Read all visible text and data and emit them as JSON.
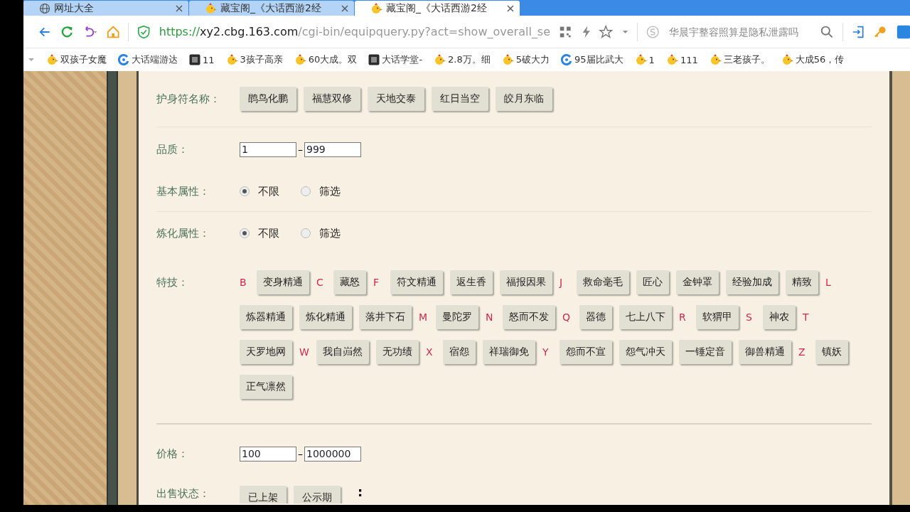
{
  "tabs": [
    {
      "title": "网址大全",
      "selected": false
    },
    {
      "title": "藏宝阁_《大话西游2经",
      "selected": false
    },
    {
      "title": "藏宝阁_《大话西游2经",
      "selected": true
    }
  ],
  "address_bar": {
    "scheme": "https://",
    "host": "xy2.cbg.163.com",
    "path": "/cgi-bin/equipquery.py?act=show_overall_se"
  },
  "search": {
    "placeholder": "华晨宇整容照算是隐私泄露吗"
  },
  "bookmarks": [
    "双孩子女魔",
    "大话端游达",
    "11",
    "3孩子高亲",
    "60大成。双",
    "大话学堂-",
    "2.8万。细",
    "5破大力",
    "95届比武大",
    "1",
    "111",
    "三老孩子。",
    "大成56，传"
  ],
  "amulet": {
    "label": "护身符名称：",
    "options": [
      "鹍鸟化鹏",
      "福慧双修",
      "天地交泰",
      "红日当空",
      "皎月东临"
    ]
  },
  "quality": {
    "label": "品质：",
    "min": "1",
    "separator": "–",
    "max": "999"
  },
  "basic_attr": {
    "label": "基本属性：",
    "options": [
      {
        "label": "不限",
        "selected": true
      },
      {
        "label": "筛选",
        "selected": false
      }
    ]
  },
  "refine_attr": {
    "label": "炼化属性：",
    "options": [
      {
        "label": "不限",
        "selected": true
      },
      {
        "label": "筛选",
        "selected": false
      }
    ]
  },
  "skills": {
    "label": "特技：",
    "items": [
      {
        "kind": "letter",
        "text": "B"
      },
      {
        "kind": "button",
        "text": "变身精通"
      },
      {
        "kind": "letter",
        "text": "C"
      },
      {
        "kind": "button",
        "text": "藏怒"
      },
      {
        "kind": "letter",
        "text": "F"
      },
      {
        "kind": "button",
        "text": "符文精通"
      },
      {
        "kind": "button",
        "text": "返生香"
      },
      {
        "kind": "button",
        "text": "福报因果"
      },
      {
        "kind": "letter",
        "text": "J"
      },
      {
        "kind": "button",
        "text": "救命毫毛"
      },
      {
        "kind": "button",
        "text": "匠心"
      },
      {
        "kind": "button",
        "text": "金钟罩"
      },
      {
        "kind": "button",
        "text": "经验加成"
      },
      {
        "kind": "button",
        "text": "精致"
      },
      {
        "kind": "letter",
        "text": "L"
      },
      {
        "kind": "button",
        "text": "炼器精通"
      },
      {
        "kind": "button",
        "text": "炼化精通"
      },
      {
        "kind": "button",
        "text": "落井下石"
      },
      {
        "kind": "letter",
        "text": "M"
      },
      {
        "kind": "button",
        "text": "曼陀罗"
      },
      {
        "kind": "letter",
        "text": "N"
      },
      {
        "kind": "button",
        "text": "怒而不发"
      },
      {
        "kind": "letter",
        "text": "Q"
      },
      {
        "kind": "button",
        "text": "器德"
      },
      {
        "kind": "button",
        "text": "七上八下"
      },
      {
        "kind": "letter",
        "text": "R"
      },
      {
        "kind": "button",
        "text": "软猬甲"
      },
      {
        "kind": "letter",
        "text": "S"
      },
      {
        "kind": "button",
        "text": "神农"
      },
      {
        "kind": "letter",
        "text": "T"
      },
      {
        "kind": "button",
        "text": "天罗地网"
      },
      {
        "kind": "letter",
        "text": "W"
      },
      {
        "kind": "button",
        "text": "我自岿然"
      },
      {
        "kind": "button",
        "text": "无功绩"
      },
      {
        "kind": "letter",
        "text": "X"
      },
      {
        "kind": "button",
        "text": "宿怨"
      },
      {
        "kind": "button",
        "text": "祥瑞御免"
      },
      {
        "kind": "letter",
        "text": "Y"
      },
      {
        "kind": "button",
        "text": "怨而不宣"
      },
      {
        "kind": "button",
        "text": "怨气冲天"
      },
      {
        "kind": "button",
        "text": "一锤定音"
      },
      {
        "kind": "button",
        "text": "御兽精通"
      },
      {
        "kind": "letter",
        "text": "Z"
      },
      {
        "kind": "button",
        "text": "镇妖"
      },
      {
        "kind": "button",
        "text": "正气凛然"
      }
    ]
  },
  "price": {
    "label": "价格：",
    "min": "100",
    "separator": "–",
    "max": "1000000"
  },
  "sale_status": {
    "label": "出售状态：",
    "options": [
      "已上架",
      "公示期"
    ],
    "trailing": ":"
  }
}
